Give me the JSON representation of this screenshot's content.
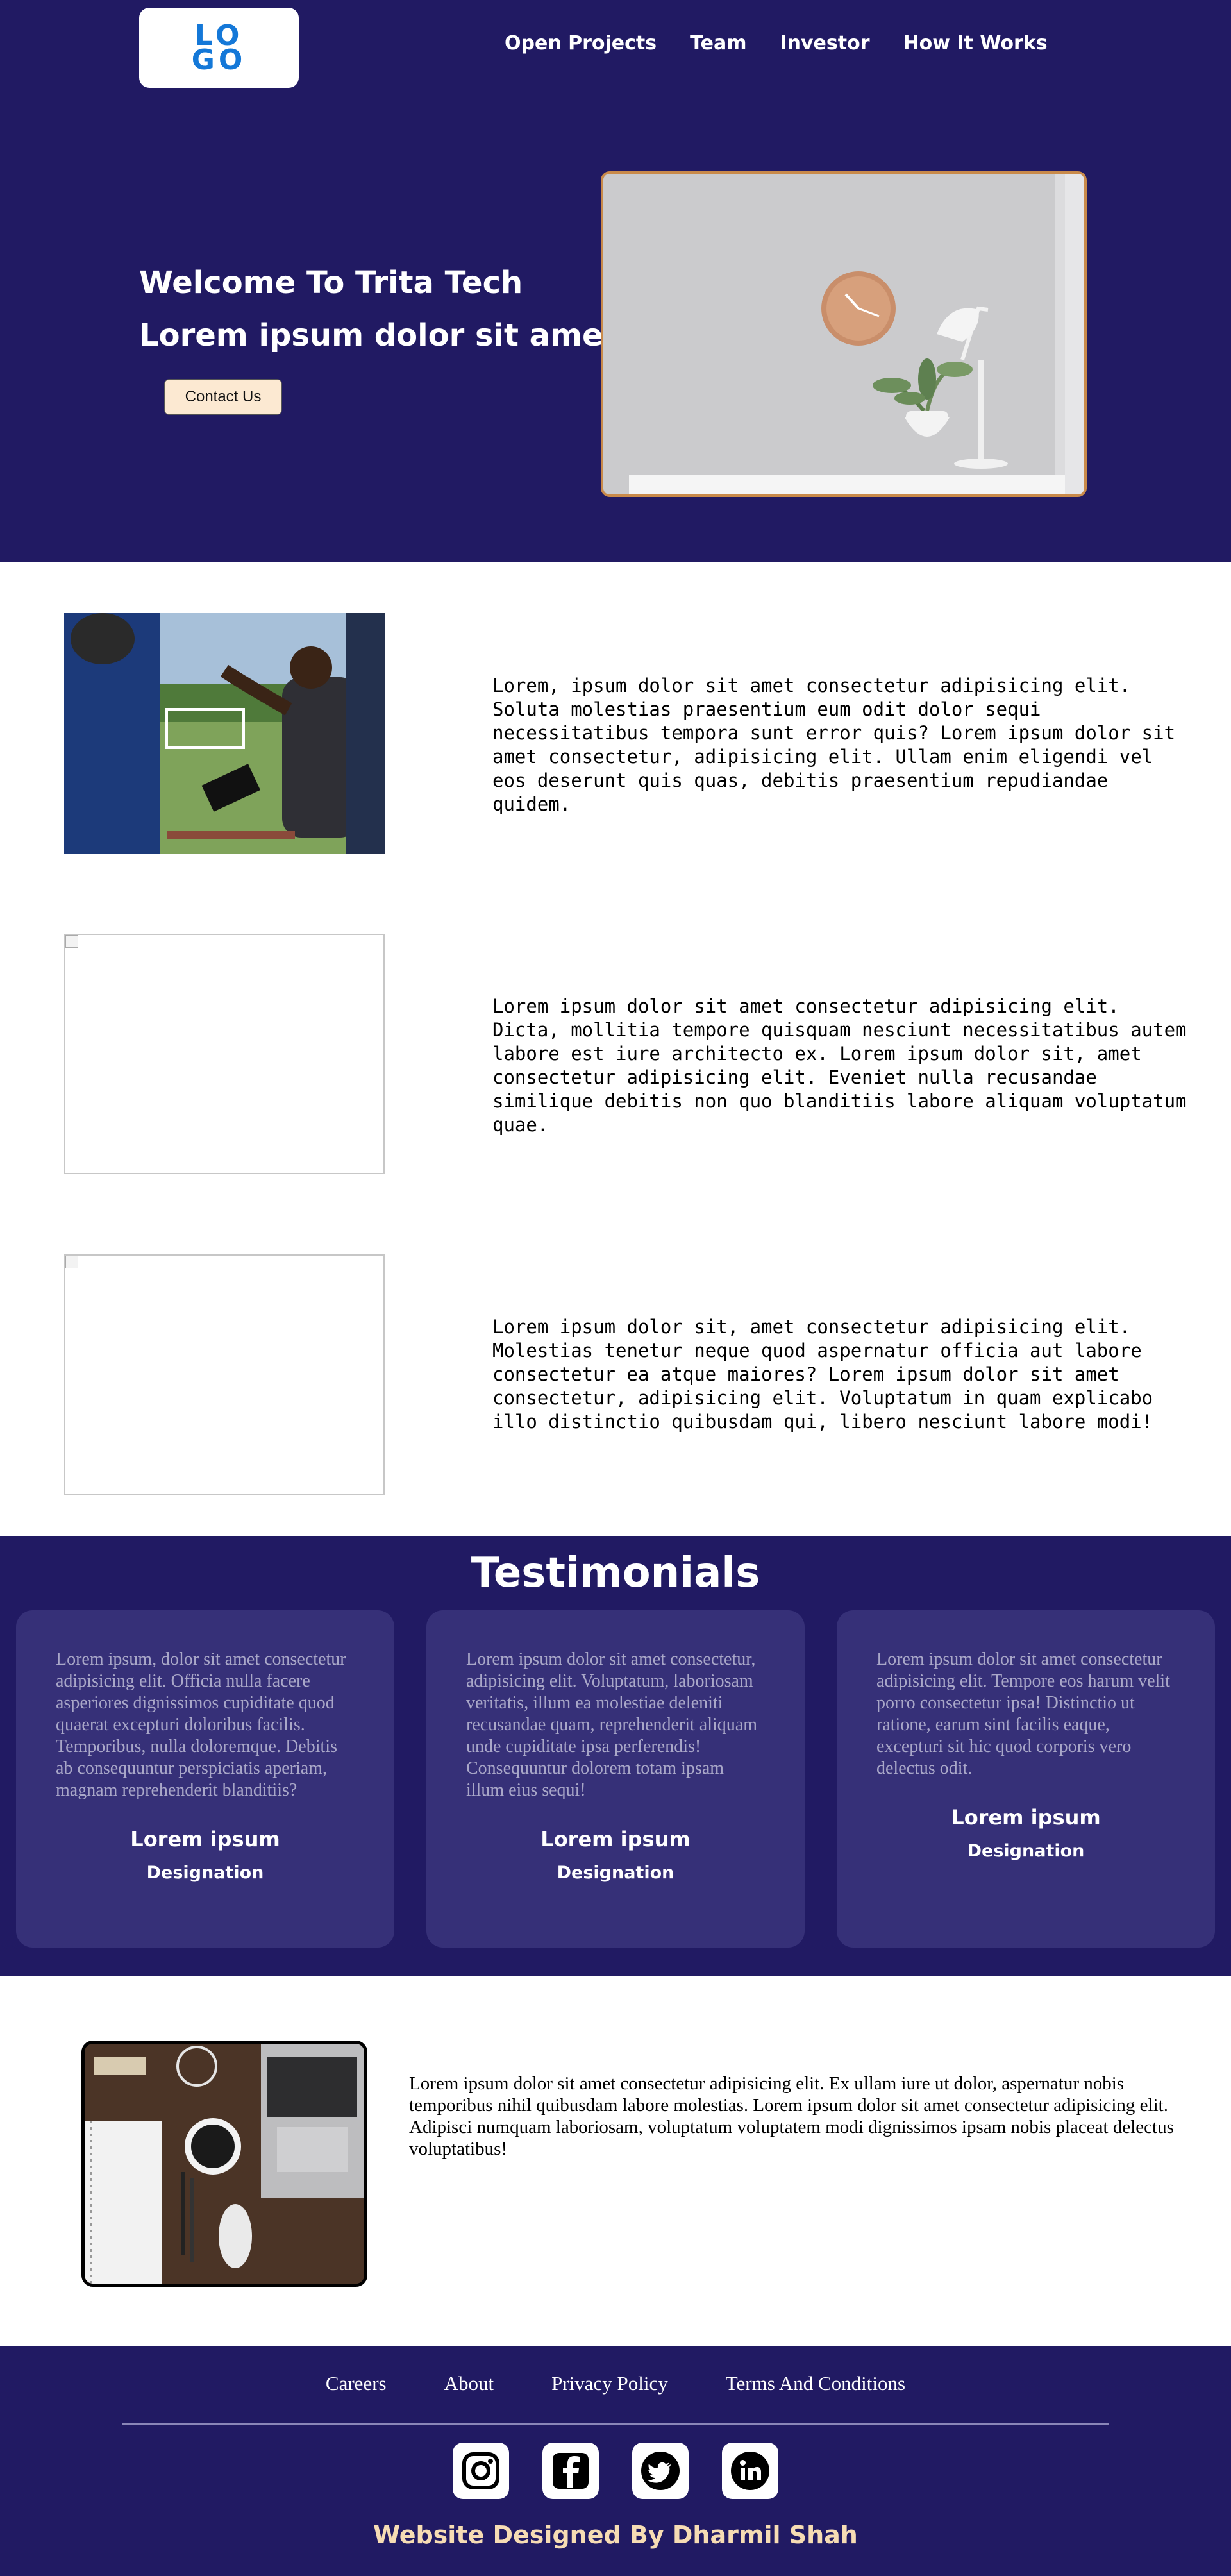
{
  "header": {
    "logo_text": "LOGO",
    "nav": [
      "Open Projects",
      "Team",
      "Investor",
      "How It Works"
    ]
  },
  "hero": {
    "title_line1": "Welcome To Trita Tech",
    "title_line2": "Lorem ipsum dolor sit amet.",
    "contact_button": "Contact Us"
  },
  "features": [
    {
      "text": "Lorem, ipsum dolor sit amet consectetur adipisicing elit. Soluta molestias praesentium eum odit dolor sequi necessitatibus tempora sunt error quis? Lorem ipsum dolor sit amet consectetur, adipisicing elit. Ullam enim eligendi vel eos deserunt quis quas, debitis praesentium repudiandae quidem."
    },
    {
      "text": "Lorem ipsum dolor sit amet consectetur adipisicing elit. Dicta, mollitia tempore quisquam nesciunt necessitatibus autem labore est iure architecto ex. Lorem ipsum dolor sit, amet consectetur adipisicing elit. Eveniet nulla recusandae similique debitis non quo blanditiis labore aliquam voluptatum quae."
    },
    {
      "text": "Lorem ipsum dolor sit, amet consectetur adipisicing elit. Molestias tenetur neque quod aspernatur officia aut labore consectetur ea atque maiores? Lorem ipsum dolor sit amet consectetur, adipisicing elit. Voluptatum in quam explicabo illo distinctio quibusdam qui, libero nesciunt labore modi!"
    }
  ],
  "testimonials": {
    "title": "Testimonials",
    "cards": [
      {
        "quote": "Lorem ipsum, dolor sit amet consectetur adipisicing elit. Officia nulla facere asperiores dignissimos cupiditate quod quaerat excepturi doloribus facilis. Temporibus, nulla doloremque. Debitis ab consequuntur perspiciatis aperiam, magnam reprehenderit blanditiis?",
        "name": "Lorem ipsum",
        "role": "Designation"
      },
      {
        "quote": "Lorem ipsum dolor sit amet consectetur, adipisicing elit. Voluptatum, laboriosam veritatis, illum ea molestiae deleniti recusandae quam, reprehenderit aliquam unde cupiditate ipsa perferendis! Consequuntur dolorem totam ipsam illum eius sequi!",
        "name": "Lorem ipsum",
        "role": "Designation"
      },
      {
        "quote": "Lorem ipsum dolor sit amet consectetur adipisicing elit. Tempore eos harum velit porro consectetur ipsa! Distinctio ut ratione, earum sint facilis eaque, excepturi sit hic quod corporis vero delectus odit.",
        "name": "Lorem ipsum",
        "role": "Designation"
      }
    ]
  },
  "about": {
    "text": "Lorem ipsum dolor sit amet consectetur adipisicing elit. Ex ullam iure ut dolor, aspernatur nobis temporibus nihil quibusdam labore molestias. Lorem ipsum dolor sit amet consectetur adipisicing elit. Adipisci numquam laboriosam, voluptatum voluptatem modi dignissimos ipsam nobis placeat delectus voluptatibus!"
  },
  "footer": {
    "links": [
      "Careers",
      "About",
      "Privacy Policy",
      "Terms And Conditions"
    ],
    "socials": [
      "instagram-icon",
      "facebook-icon",
      "twitter-icon",
      "linkedin-icon"
    ],
    "credit": "Website Designed By Dharmil Shah"
  },
  "colors": {
    "navy": "#211a63",
    "card": "#363078",
    "logo_blue": "#1478d8",
    "button_cream": "#fce9d2",
    "credit_cream": "#f6dcb4"
  }
}
